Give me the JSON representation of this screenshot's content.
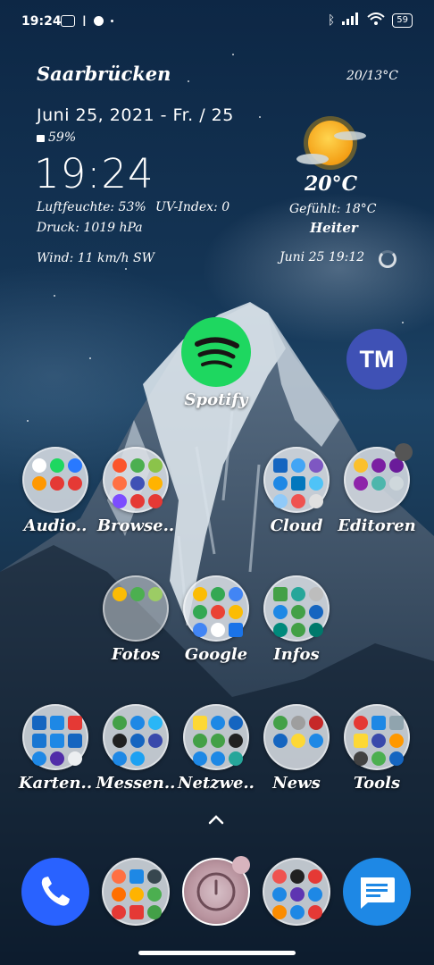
{
  "status_bar": {
    "time": "19:24",
    "battery": "59"
  },
  "widget": {
    "city": "Saarbrücken",
    "hilo": "20/13°C",
    "date": "Juni 25, 2021 - Fr. / 25",
    "battery": "59%",
    "clock": "19:24",
    "humidity": "Luftfeuchte: 53%",
    "uv": "UV-Index: 0",
    "pressure": "Druck: 1019 hPa",
    "wind": "Wind: 11 km/h SW",
    "temp": "20°C",
    "feels": "Gefühlt: 18°C",
    "condition": "Heiter",
    "updated": "Juni 25  19:12"
  },
  "apps": {
    "spotify": "Spotify",
    "tm": "TM",
    "audio": "Audio..",
    "browser": "Browse..",
    "cloud": "Cloud",
    "editoren": "Editoren",
    "fotos": "Fotos",
    "google": "Google",
    "infos": "Infos",
    "karten": "Karten..",
    "messenger": "Messen..",
    "netzwerk": "Netzwe..",
    "news": "News",
    "tools": "Tools"
  },
  "colors": {
    "spotify": "#1ed760",
    "tm_avatar": "#3f51b5",
    "phone": "#2962ff",
    "messages": "#1e88e5"
  }
}
